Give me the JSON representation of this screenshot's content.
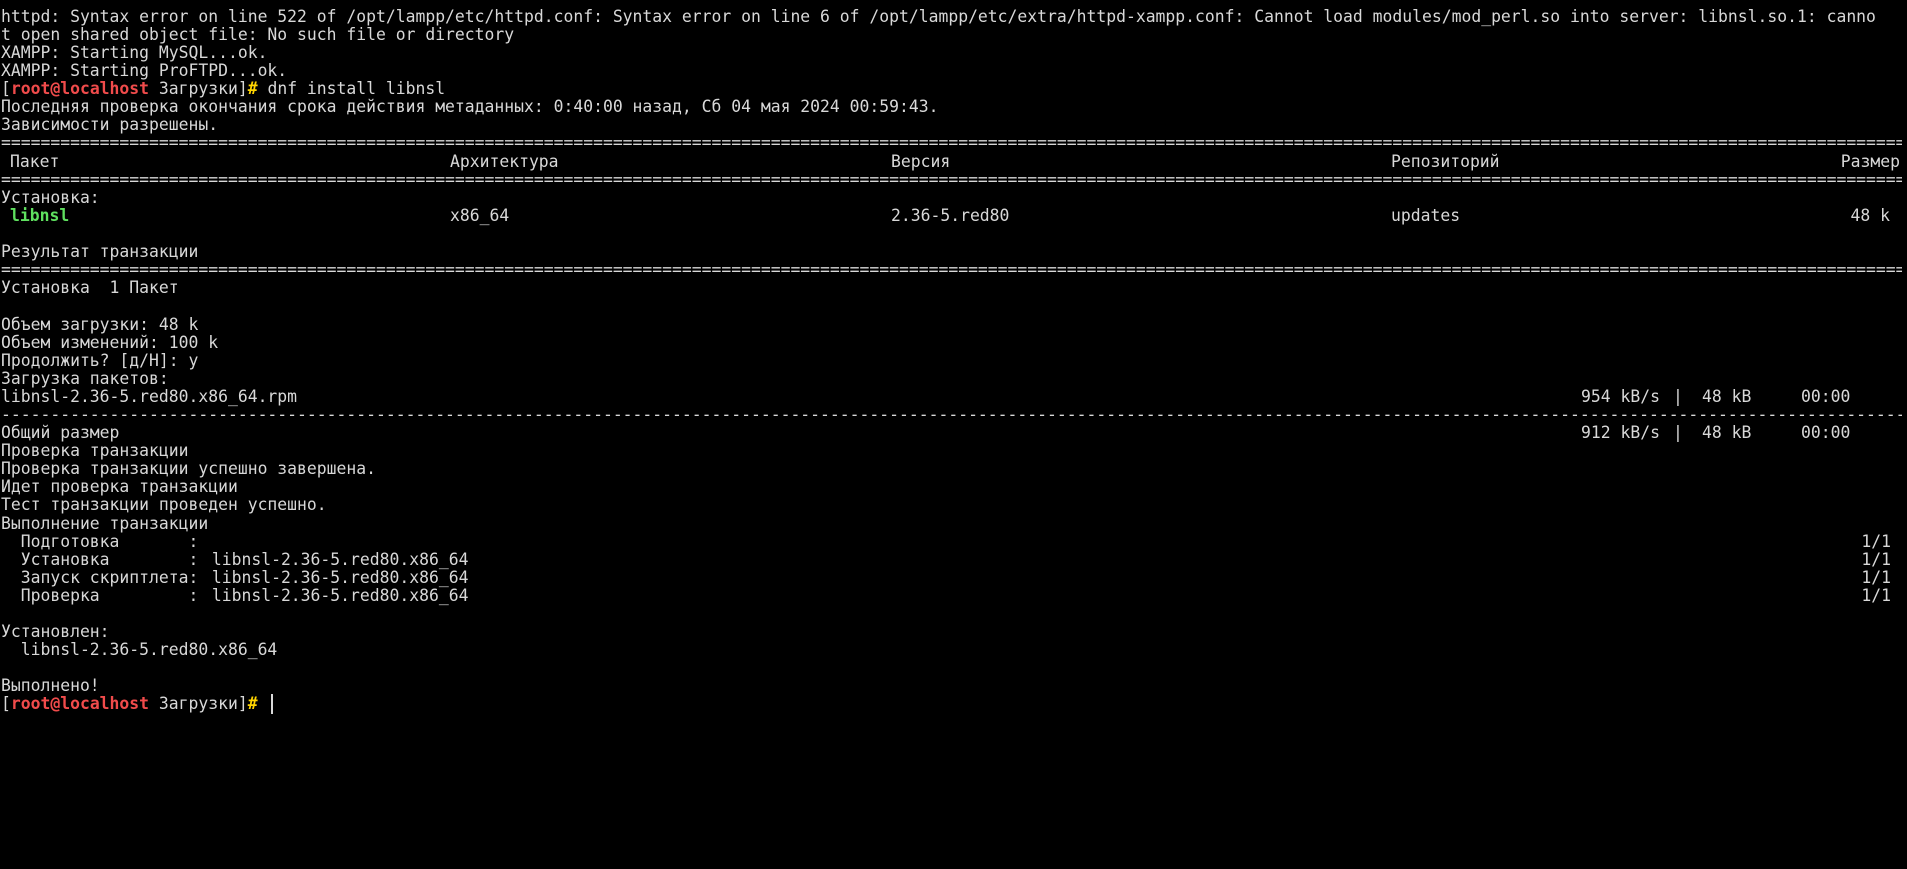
{
  "error": {
    "line1": "httpd: Syntax error on line 522 of /opt/lampp/etc/httpd.conf: Syntax error on line 6 of /opt/lampp/etc/extra/httpd-xampp.conf: Cannot load modules/mod_perl.so into server: libnsl.so.1: canno",
    "line2": "t open shared object file: No such file or directory"
  },
  "xampp": {
    "mysql": "XAMPP: Starting MySQL...ok.",
    "proftpd": "XAMPP: Starting ProFTPD...ok."
  },
  "prompt": {
    "open": "[",
    "user": "root@localhost",
    "dir": " Загрузки]",
    "hash": "#",
    "command": " dnf install libnsl"
  },
  "meta": {
    "last_check": "Последняя проверка окончания срока действия метаданных: 0:40:00 назад, Сб 04 мая 2024 00:59:43.",
    "deps_resolved": "Зависимости разрешены."
  },
  "separators": {
    "double": "========================================================================================================================================================================================================",
    "single": "--------------------------------------------------------------------------------------------------------------------------------------------------------------------------------------------------------"
  },
  "table": {
    "headers": {
      "package": "Пакет",
      "arch": "Архитектура",
      "version": "Версия",
      "repo": "Репозиторий",
      "size": "Размер"
    },
    "section": "Установка:",
    "row": {
      "package": "libnsl",
      "arch": "x86_64",
      "version": "2.36-5.red80",
      "repo": "updates",
      "size": "48 k"
    }
  },
  "summary": {
    "title": "Результат транзакции",
    "install_count": "Установка  1 Пакет",
    "download_size": "Объем загрузки: 48 k",
    "installed_size": "Объем изменений: 100 k",
    "confirm": "Продолжить? [д/Н]: y",
    "downloading": "Загрузка пакетов:"
  },
  "download": {
    "file": "libnsl-2.36-5.red80.x86_64.rpm",
    "speed": "954 kB/s",
    "size": "48 kB",
    "time": "00:00",
    "pipe": "|"
  },
  "total": {
    "label": "Общий размер",
    "speed": "912 kB/s",
    "size": "48 kB",
    "time": "00:00",
    "pipe": "|"
  },
  "transaction": {
    "check": "Проверка транзакции",
    "check_ok": "Проверка транзакции успешно завершена.",
    "testing": "Идет проверка транзакции",
    "test_ok": "Тест транзакции проведен успешно.",
    "running": "Выполнение транзакции",
    "steps": [
      {
        "label": "  Подготовка       :",
        "value": "",
        "progress": "1/1"
      },
      {
        "label": "  Установка        :",
        "value": " libnsl-2.36-5.red80.x86_64",
        "progress": "1/1"
      },
      {
        "label": "  Запуск скриптлета:",
        "value": " libnsl-2.36-5.red80.x86_64",
        "progress": "1/1"
      },
      {
        "label": "  Проверка         :",
        "value": " libnsl-2.36-5.red80.x86_64",
        "progress": "1/1"
      }
    ]
  },
  "result": {
    "installed_title": "Установлен:",
    "installed_pkg": "  libnsl-2.36-5.red80.x86_64",
    "done": "Выполнено!"
  },
  "prompt2": {
    "open": "[",
    "user": "root@localhost",
    "dir": " Загрузки]",
    "hash": "#"
  },
  "colors": {
    "background": "#000000",
    "text": "#d8d8d8",
    "user": "#f04b4b",
    "hash": "#ffd400",
    "package": "#5fe05f"
  }
}
